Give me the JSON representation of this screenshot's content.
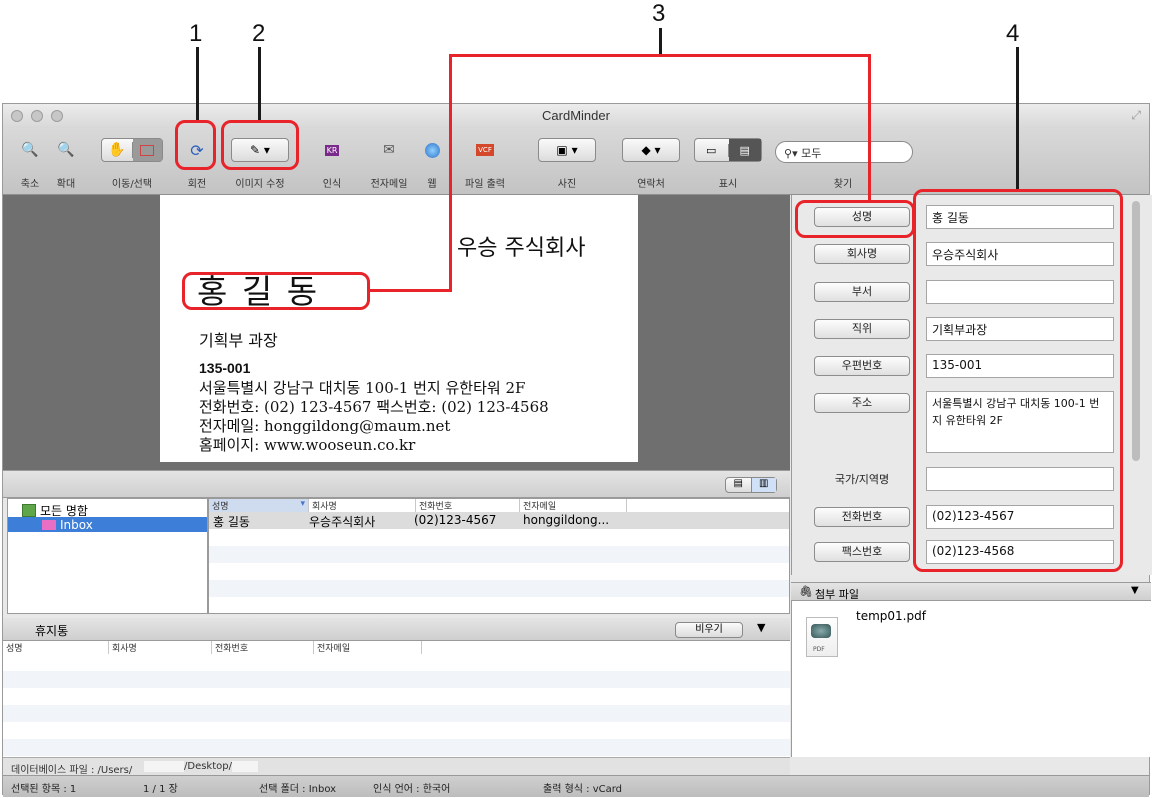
{
  "callouts": [
    "1",
    "2",
    "3",
    "4"
  ],
  "window": {
    "title": "CardMinder"
  },
  "toolbar": {
    "zoom_out": "축소",
    "zoom_in": "확대",
    "move_select": "이동/선택",
    "rotate": "회전",
    "edit_image": "이미지 수정",
    "recognize": "인식",
    "email": "전자메일",
    "web": "웹",
    "file_output": "파일 출력",
    "photo": "사진",
    "contacts": "연락처",
    "display": "표시",
    "search_label": "찾기",
    "search_value": "모두",
    "recognize_badge": "KR",
    "file_badge": "VCF"
  },
  "card": {
    "company": "우승 주식회사",
    "name": "홍  길  동",
    "title": "기획부 과장",
    "zip": "135-001",
    "address": "서울특별시 강남구 대치동 100-1 번지 유한타워 2F",
    "phone": "전화번호: (02) 123-4567   팩스번호: (02) 123-4568",
    "email": "전자메일: honggildong@maum.net",
    "homepage": "홈페이지: www.wooseun.co.kr"
  },
  "tree": {
    "all_cards": "모든 명함",
    "inbox": "Inbox"
  },
  "list": {
    "headers": [
      "성명",
      "회사명",
      "전화번호",
      "전자메일"
    ],
    "row": {
      "name": "홍 길동",
      "company": "우승주식회사",
      "phone": "(02)123-4567",
      "email": "honggildong..."
    }
  },
  "trash": {
    "title": "휴지통",
    "empty_button": "비우기",
    "headers": [
      "성명",
      "회사명",
      "전화번호",
      "전자메일"
    ]
  },
  "db_path": {
    "label": "데이터베이스 파일 : /Users/",
    "suffix": "/Desktop/"
  },
  "status": {
    "selected": "선택된 항목 : 1",
    "page": "1 / 1 장",
    "folder": "선택 폴더 : Inbox",
    "lang": "인식 언어 : 한국어",
    "format": "출력 형식 : vCard"
  },
  "fields": {
    "name": {
      "label": "성명",
      "value": "홍 길동"
    },
    "company": {
      "label": "회사명",
      "value": "우승주식회사"
    },
    "dept": {
      "label": "부서",
      "value": ""
    },
    "position": {
      "label": "직위",
      "value": "기획부과장"
    },
    "zip": {
      "label": "우편번호",
      "value": "135-001"
    },
    "address": {
      "label": "주소",
      "value": "서울특별시 강남구 대치동 100-1 번지 유한타워 2F"
    },
    "country": {
      "label": "국가/지역명",
      "value": ""
    },
    "phone": {
      "label": "전화번호",
      "value": "(02)123-4567"
    },
    "fax": {
      "label": "팩스번호",
      "value": "(02)123-4568"
    }
  },
  "attachments": {
    "title": "첨부 파일",
    "file": "temp01.pdf",
    "badge": "PDF"
  },
  "colors": {
    "annotation": "#e8232a",
    "selection": "#3d7fd8"
  }
}
